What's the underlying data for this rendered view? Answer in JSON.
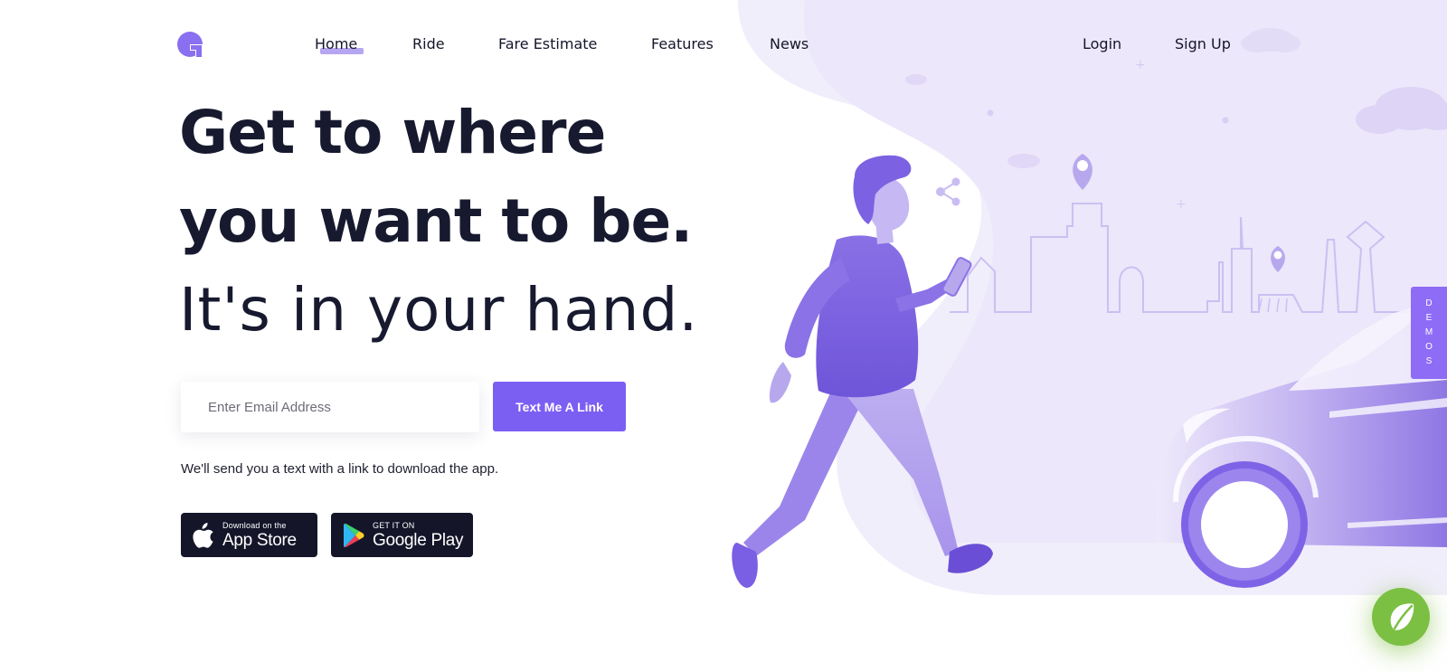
{
  "nav": {
    "logo_alt": "G",
    "items": [
      {
        "label": "Home",
        "active": true
      },
      {
        "label": "Ride"
      },
      {
        "label": "Fare Estimate"
      },
      {
        "label": "Features"
      },
      {
        "label": "News"
      }
    ],
    "login_label": "Login",
    "signup_label": "Sign Up"
  },
  "hero": {
    "line1": "Get to where",
    "line2": "you want to be.",
    "line3": "It's in your hand."
  },
  "form": {
    "email_placeholder": "Enter Email Address",
    "email_value": "",
    "button_label": "Text Me A Link",
    "helper_text": "We'll send you a text with a link to download the app."
  },
  "badges": {
    "apple": {
      "small": "Download on the",
      "big": "App Store",
      "icon": "apple-icon"
    },
    "google": {
      "small": "GET IT ON",
      "big": "Google Play",
      "icon": "google-play-icon"
    }
  },
  "demos_tab": {
    "letters": [
      "D",
      "E",
      "M",
      "O",
      "S"
    ]
  },
  "chat_widget": {
    "icon": "leaf-icon"
  },
  "colors": {
    "accent": "#7b5ff3",
    "heading": "#171a2f",
    "illustration_light": "#efeafb",
    "illustration_mid": "#9a84e6",
    "illustration_dark": "#6a4fd6",
    "widget_green": "#7bc043"
  }
}
